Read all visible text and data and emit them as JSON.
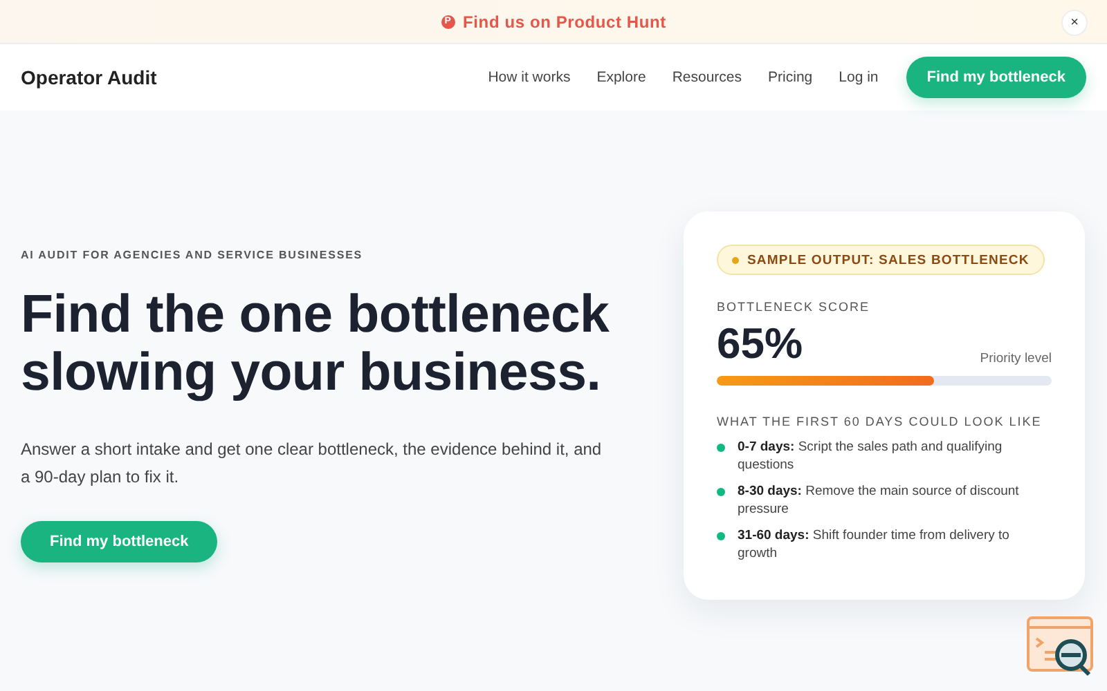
{
  "banner": {
    "icon_letter": "P",
    "text": "Find us on Product Hunt",
    "close": "×"
  },
  "nav": {
    "brand": "Operator Audit",
    "links": [
      "How it works",
      "Explore",
      "Resources",
      "Pricing",
      "Log in"
    ],
    "cta": "Find my bottleneck"
  },
  "hero": {
    "eyebrow": "AI AUDIT FOR AGENCIES AND SERVICE BUSINESSES",
    "headline": [
      "Find the one bottleneck",
      "slowing your business."
    ],
    "lead": "Answer a short intake and get one clear bottleneck, the evidence behind it, and a 90-day plan to fix it.",
    "cta": "Find my bottleneck"
  },
  "card": {
    "badge": "SAMPLE OUTPUT: SALES BOTTLENECK",
    "score_label": "BOTTLENECK SCORE",
    "score": "65%",
    "level_label": "Priority level",
    "level": 0.65,
    "plan_title": "WHAT THE FIRST 60 DAYS COULD LOOK LIKE",
    "plan": [
      {
        "text": "**0-7 days:** Script the sales path and qualifying questions",
        "color": "#10b981"
      },
      {
        "text": "**8-30 days:** Remove the main source of discount pressure",
        "color": "#10b981"
      },
      {
        "text": "**31-60 days:** Shift founder time from delivery to growth",
        "color": "#10b981"
      }
    ]
  }
}
